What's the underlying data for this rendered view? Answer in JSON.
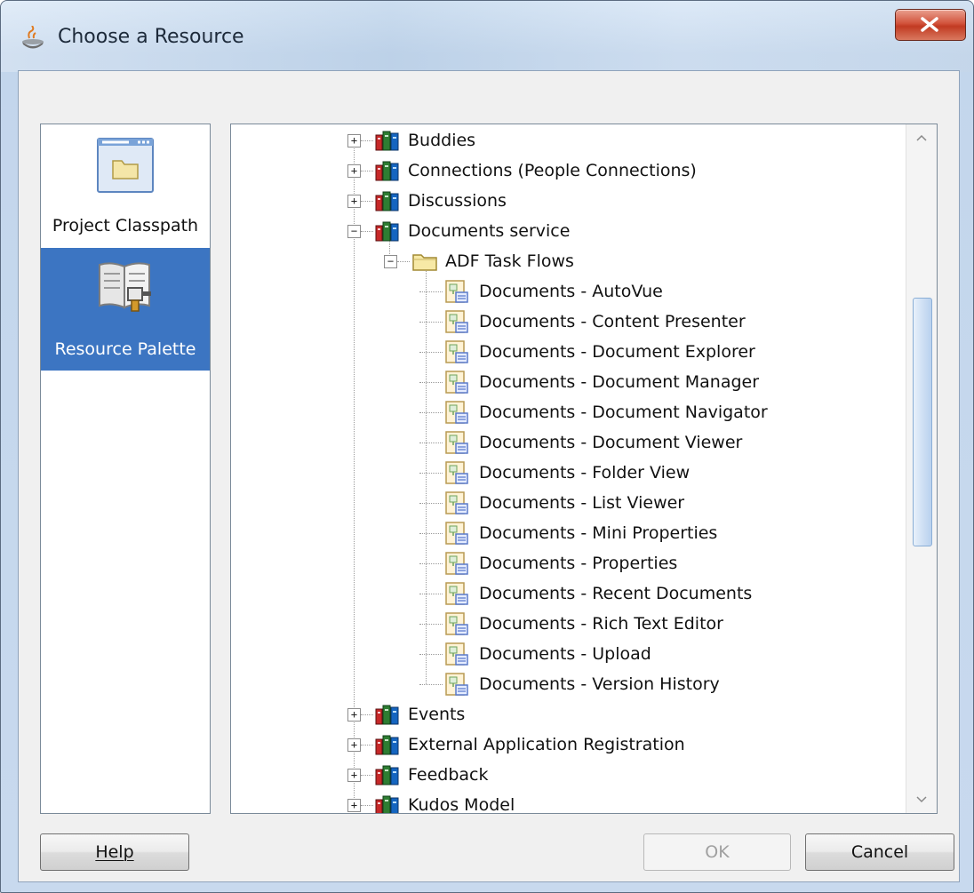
{
  "window": {
    "title": "Choose a Resource",
    "close_icon": "close-icon"
  },
  "sidebar": {
    "items": [
      {
        "label": "Project Classpath",
        "icon": "folder-window-icon",
        "selected": false
      },
      {
        "label": "Resource Palette",
        "icon": "resource-palette-icon",
        "selected": true
      }
    ]
  },
  "tree": {
    "items": [
      {
        "label": "Buddies",
        "level": 0,
        "expander": "+",
        "icon": "books-icon"
      },
      {
        "label": "Connections (People Connections)",
        "level": 0,
        "expander": "+",
        "icon": "books-icon"
      },
      {
        "label": "Discussions",
        "level": 0,
        "expander": "+",
        "icon": "books-icon"
      },
      {
        "label": "Documents service",
        "level": 0,
        "expander": "-",
        "icon": "books-icon"
      },
      {
        "label": "ADF Task Flows",
        "level": 1,
        "expander": "-",
        "icon": "folder-icon"
      },
      {
        "label": "Documents - AutoVue",
        "level": 2,
        "icon": "task-flow-icon"
      },
      {
        "label": "Documents - Content Presenter",
        "level": 2,
        "icon": "task-flow-icon"
      },
      {
        "label": "Documents - Document Explorer",
        "level": 2,
        "icon": "task-flow-icon"
      },
      {
        "label": "Documents - Document Manager",
        "level": 2,
        "icon": "task-flow-icon"
      },
      {
        "label": "Documents - Document Navigator",
        "level": 2,
        "icon": "task-flow-icon"
      },
      {
        "label": "Documents - Document Viewer",
        "level": 2,
        "icon": "task-flow-icon"
      },
      {
        "label": "Documents - Folder View",
        "level": 2,
        "icon": "task-flow-icon"
      },
      {
        "label": "Documents - List Viewer",
        "level": 2,
        "icon": "task-flow-icon"
      },
      {
        "label": "Documents - Mini Properties",
        "level": 2,
        "icon": "task-flow-icon"
      },
      {
        "label": "Documents - Properties",
        "level": 2,
        "icon": "task-flow-icon"
      },
      {
        "label": "Documents - Recent Documents",
        "level": 2,
        "icon": "task-flow-icon"
      },
      {
        "label": "Documents - Rich Text Editor",
        "level": 2,
        "icon": "task-flow-icon"
      },
      {
        "label": "Documents - Upload",
        "level": 2,
        "icon": "task-flow-icon"
      },
      {
        "label": "Documents - Version History",
        "level": 2,
        "icon": "task-flow-icon"
      },
      {
        "label": "Events",
        "level": 0,
        "expander": "+",
        "icon": "books-icon"
      },
      {
        "label": "External Application Registration",
        "level": 0,
        "expander": "+",
        "icon": "books-icon"
      },
      {
        "label": "Feedback",
        "level": 0,
        "expander": "+",
        "icon": "books-icon"
      },
      {
        "label": "Kudos Model",
        "level": 0,
        "expander": "+",
        "icon": "books-icon"
      }
    ]
  },
  "buttons": {
    "help": "Help",
    "ok": "OK",
    "cancel": "Cancel"
  },
  "colors": {
    "selection": "#3c75c2",
    "title_text": "#1d2a3a"
  }
}
